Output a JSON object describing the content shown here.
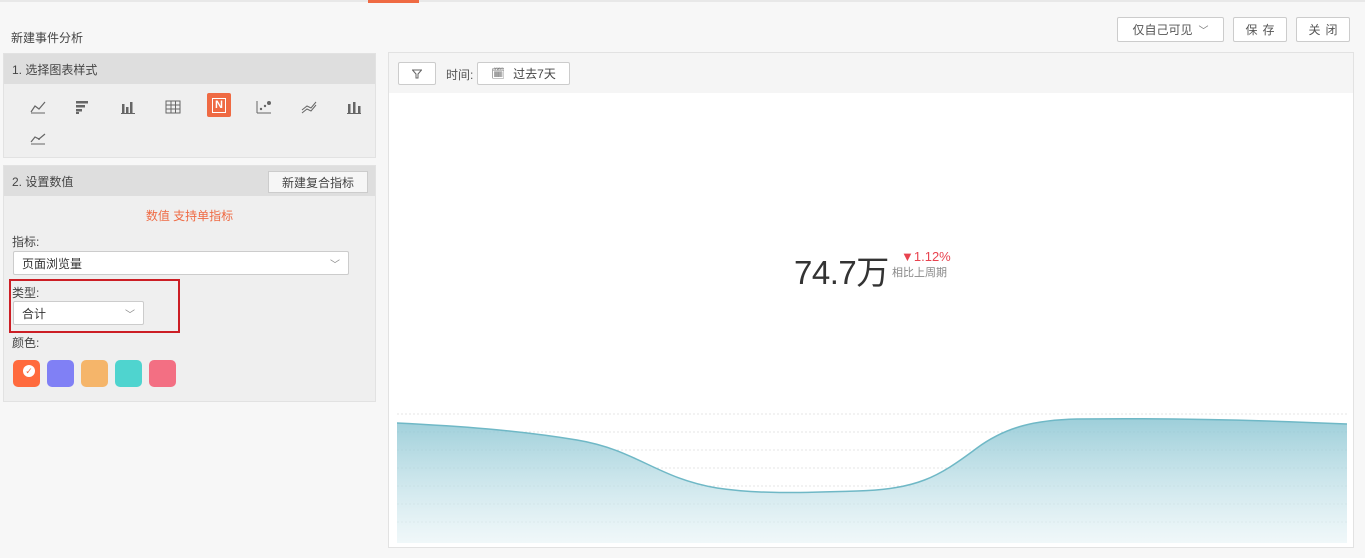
{
  "page": {
    "title": "新建事件分析"
  },
  "toolbar": {
    "visibility_label": "仅自己可见",
    "save_label": "保存",
    "close_label": "关闭"
  },
  "sidebar": {
    "chart_style": {
      "heading": "1. 选择图表样式",
      "icons": [
        {
          "name": "line-chart-icon",
          "glyph": "⟋",
          "active": false
        },
        {
          "name": "horizontal-bar-chart-icon",
          "glyph": "☰",
          "active": false
        },
        {
          "name": "bar-chart-icon",
          "glyph": "ılı",
          "active": false
        },
        {
          "name": "table-icon",
          "glyph": "⊞",
          "active": false
        },
        {
          "name": "number-card-icon",
          "glyph": "N",
          "active": true
        },
        {
          "name": "scatter-chart-icon",
          "glyph": "⁚",
          "active": false
        },
        {
          "name": "stacked-line-chart-icon",
          "glyph": "≈",
          "active": false
        },
        {
          "name": "stacked-bar-chart-icon",
          "glyph": "ılı",
          "active": false
        },
        {
          "name": "area-line-chart-icon",
          "glyph": "⟋",
          "active": false
        }
      ]
    },
    "set_value": {
      "heading": "2. 设置数值",
      "composite_button": "新建复合指标",
      "hint": "数值 支持单指标",
      "metric_label": "指标:",
      "metric_value": "页面浏览量",
      "type_label": "类型:",
      "type_value": "合计",
      "color_label": "颜色:",
      "colors": [
        "#ff6a3d",
        "#8080f5",
        "#f5b56a",
        "#4fd4cf",
        "#f36f83"
      ]
    }
  },
  "main": {
    "time_label": "时间:",
    "date_range": "过去7天",
    "value": "74.7万",
    "change": "▼1.12%",
    "compare_label": "相比上周期",
    "trend_color": "#4ea9b8"
  }
}
